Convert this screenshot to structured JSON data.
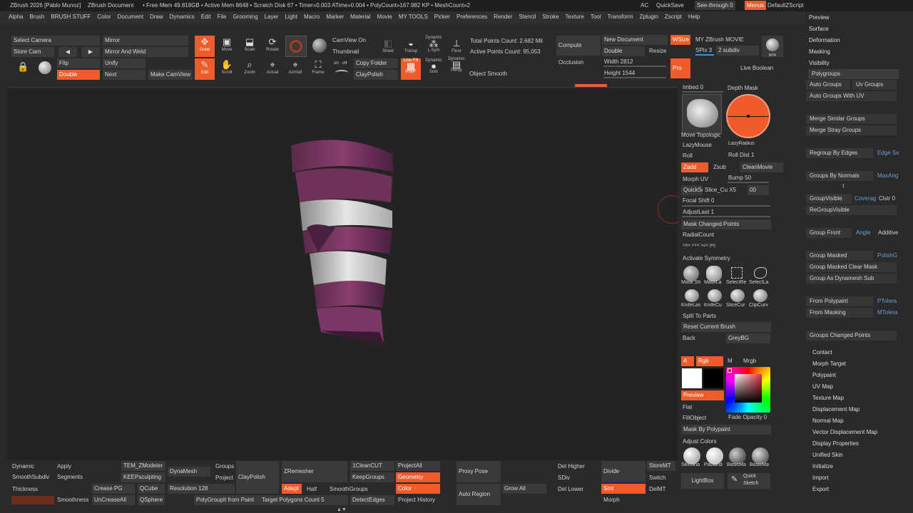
{
  "titlebar": {
    "app": "ZBrush 2026 [Pablo Munoz]",
    "doc": "ZBrush Document",
    "stats": "• Free Mem 49.818GB • Active Mem 8648 • Scratch Disk 67 • Timer»0.003 ATime»0.004 • PolyCount»167.982 KP • MeshCount»2",
    "ac": "AC",
    "quicksave": "QuickSave",
    "seethrough": "See-through 0",
    "menus": "Menus",
    "defaultzscript": "DefaultZScript"
  },
  "menubar": [
    "Alpha",
    "Brush",
    "BRUSH STUFF",
    "Color",
    "Document",
    "Draw",
    "Dynamics",
    "Edit",
    "File",
    "Grooming",
    "Layer",
    "Light",
    "Macro",
    "Marker",
    "Material",
    "Movie",
    "MY TOOLS",
    "Picker",
    "Preferences",
    "Render",
    "Stencil",
    "Stroke",
    "Texture",
    "Tool",
    "Transform",
    "Zplugin",
    "Zscript",
    "Help"
  ],
  "shelf": {
    "select_camera": "Select Camera",
    "mirror": "Mirror",
    "store_cam": "Store Cam",
    "mirror_weld": "Mirror And Weld",
    "flip": "Flip",
    "unify": "Unify",
    "double": "Double",
    "next": "Next",
    "make_camview": "Make CamView",
    "draw": "Draw",
    "move": "Move",
    "scale": "Scale",
    "rotate": "Rotate",
    "edit": "Edit",
    "scroll": "Scroll",
    "zoom": "Zoom",
    "actual": "Actual",
    "aahalf": "AAHalf",
    "frame": "Frame",
    "camview_on": "CamView On",
    "thumbnail": "Thumbnail",
    "copy_folder": "Copy Folder",
    "claypolish": "ClayPolish",
    "onoff": "on · off",
    "sheet": "Sheet",
    "transp": "Transp",
    "dynamic": "Dynamic",
    "lsym": "L.Sym",
    "floor": "Floor",
    "linefill": "Line Fill",
    "polyf": "PolyF",
    "solo": "Solo",
    "persp": "Persp",
    "object_smooth": "Object Smooth",
    "total_points": "Total Points Count: 2.682 Mil",
    "active_points": "Active Points Count: 95,053",
    "compute": "Compute",
    "occlusion": "Occlusion",
    "new_document": "New Document",
    "wsize": "WSize",
    "my_movie": "MY ZBrush MOVIE",
    "double2": "Double",
    "resize": "Resize",
    "spix": "SPix 3",
    "subdiv": "2 subdiv",
    "width": "Width 2812",
    "height": "Height 1544",
    "pro": "Pro",
    "live_boolean": "Live Boolean",
    "bpr": "BPR"
  },
  "tools": {
    "imbed": "Imbed 0",
    "depth_mask": "Depth Mask",
    "move_topo": "Move Topologic",
    "lazymouse": "LazyMouse",
    "lazyradius": "LazyRadius",
    "roll": "Roll",
    "roll_dist": "Roll Dist 1",
    "zadd": "Zadd",
    "zsub": "Zsub",
    "cleanmovie": "CleanMovie",
    "morph_uv": "Morph UV",
    "bump": "Bump 50",
    "quicksc": "QuickSc",
    "slice": "Slice_Cu X5",
    "val00": "00",
    "focal_shift": "Focal Shift 0",
    "adjustlast": "AdjustLast 1",
    "mask_changed": "Mask Changed Points",
    "radialcount": "RadialCount",
    "axes": ">X<   >Y<   >Z<        (R)",
    "activate_sym": "Activate Symmetry",
    "b1": "Mask Sh",
    "b2": "MaskLa",
    "b3": "SelectRe",
    "b4": "SelectLa",
    "b5": "KnifeLas",
    "b6": "KnifeCu",
    "b7": "SliceCur",
    "b8": "ClipCurv",
    "split_parts": "Split To Parts",
    "reset_brush": "Reset Current Brush",
    "back": "Back",
    "greybg": "GreyBG",
    "a": "A",
    "rgb": "Rgb",
    "m": "M",
    "mrgb": "Mrgb",
    "preview": "Preview",
    "flat": "Flat",
    "fillobject": "FillObject",
    "fade_opacity": "Fade Opacity 0",
    "mask_polypaint": "Mask By Polypaint",
    "adjust_colors": "Adjust Colors",
    "m1": "SkinSha",
    "m2": "Pabland",
    "m3": "BasicMa",
    "m4": "BasicMa",
    "lightbox": "LightBox",
    "quick_sketch": "Quick Sketch"
  },
  "right": {
    "preview": "Preview",
    "surface": "Surface",
    "deformation": "Deformation",
    "masking": "Masking",
    "visibility": "Visibility",
    "polygroups": "Polygroups",
    "auto_groups": "Auto Groups",
    "uv_groups": "Uv Groups",
    "auto_uv": "Auto Groups With UV",
    "merge_similar": "Merge Similar Groups",
    "merge_stray": "Merge Stray Groups",
    "regroup_edges": "Regroup By Edges",
    "edge_se": "Edge Se",
    "groups_normals": "Groups By Normals",
    "maxang": "MaxAng",
    "groupvisible": "GroupVisible",
    "coverage": "Coverag",
    "clstr": "Clstr 0",
    "regroupvisible": "ReGroupVisible",
    "group_front": "Group Front",
    "angle": "Angle",
    "additive": "Additive",
    "group_masked": "Group Masked",
    "polishg": "PolishG",
    "group_masked_clear": "Group Masked Clear Mask",
    "group_dynamesh": "Group As Dynamesh Sub",
    "from_polypaint": "From Polypaint",
    "ptolera": "PTolera",
    "from_masking": "From Masking",
    "mtolera": "MTolera",
    "groups_changed": "Groups Changed Points",
    "contact": "Contact",
    "morph_target": "Morph Target",
    "polypaint": "Polypaint",
    "uv_map": "UV Map",
    "texture_map": "Texture Map",
    "displacement_map": "Displacement Map",
    "normal_map": "Normal Map",
    "vector_disp": "Vector Displacement Map",
    "display_props": "Display Properties",
    "unified_skin": "Unified Skin",
    "initialize": "Initialize",
    "import": "Import",
    "export": "Export"
  },
  "bottom": {
    "dynamic": "Dynamic",
    "apply": "Apply",
    "smoothsubdiv": "SmoothSubdiv",
    "segments": "Segments",
    "thickness": "Thickness",
    "smoothness": "Smoothness",
    "tem_zmodeler": "TEM_ZModeler",
    "keepsculpting": "KEEPsculpting",
    "crease_pg": "Crease PG",
    "qcube": "QCube",
    "uncreaseall": "UnCreaseAll",
    "qsphere": "QSphere",
    "dynamesh": "DynaMesh",
    "resolution": "Resolution 128",
    "groups": "Groups",
    "project": "Project",
    "claypolish": "ClayPolish",
    "polygroupit": "PolyGroupIt from Paint",
    "zremesher": "ZRemesher",
    "adapt": "Adapt",
    "half": "Half",
    "smoothgroups": "SmoothGroups",
    "target_poly": "Target Polygons Count 5",
    "onecleancut": "1CleanCUT",
    "keepgroups": "KeepGroups",
    "detectedges": "DetectEdges",
    "projectall": "ProjectAll",
    "geometry": "Geometry",
    "color": "Color",
    "project_history": "Project History",
    "proxy_pose": "Proxy Pose",
    "auto_region": "Auto Region",
    "grow_all": "Grow All",
    "del_higher": "Del Higher",
    "sdiv": "SDiv",
    "del_lower": "Del Lower",
    "divide": "Divide",
    "smt": "Smt",
    "morph": "Morph",
    "storemt": "StoreMT",
    "switch": "Switch",
    "delmt": "DelMT"
  }
}
